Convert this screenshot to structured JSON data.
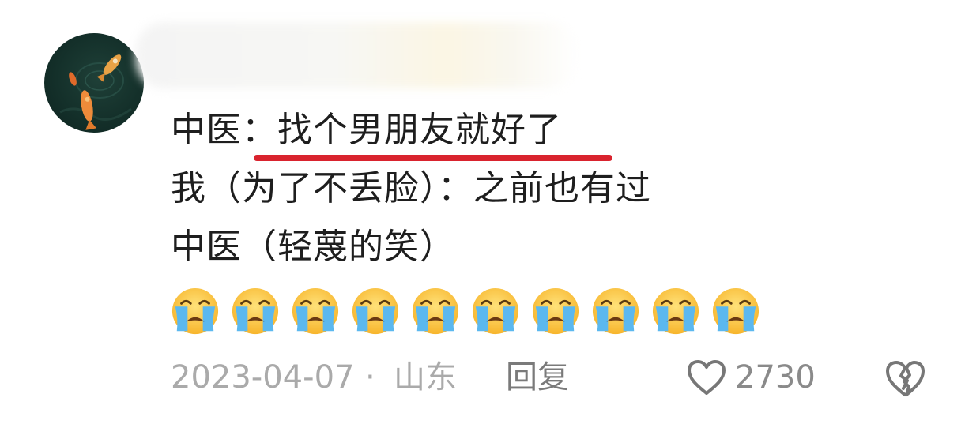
{
  "comment": {
    "lines": [
      {
        "prefix": "中医：",
        "highlight": "找个男朋友就好了"
      },
      {
        "text": "我（为了不丢脸）：之前也有过"
      },
      {
        "text": "中医（轻蔑的笑）"
      }
    ],
    "emoji": [
      "loudly-crying-face",
      "loudly-crying-face",
      "loudly-crying-face",
      "loudly-crying-face",
      "loudly-crying-face",
      "loudly-crying-face",
      "loudly-crying-face",
      "loudly-crying-face",
      "loudly-crying-face",
      "loudly-crying-face"
    ]
  },
  "meta": {
    "date": "2023-04-07",
    "separator": "·",
    "location": "山东",
    "reply_label": "回复",
    "like_count": "2730"
  },
  "colors": {
    "highlight_underline": "#d9232e",
    "meta_text": "#aaaaaa"
  },
  "icons": {
    "avatar": "koi-fish-pond-avatar",
    "like": "heart-outline-icon",
    "dislike": "broken-heart-icon"
  }
}
